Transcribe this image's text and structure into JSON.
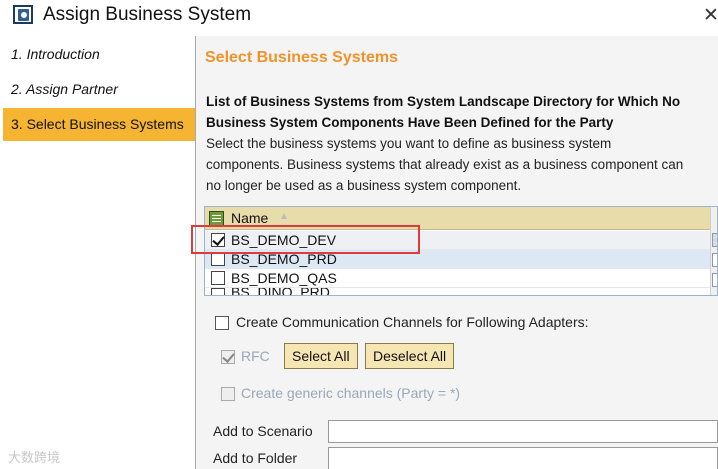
{
  "window": {
    "title": "Assign Business System",
    "close_label": "✕"
  },
  "nav": {
    "items": [
      {
        "label": "1. Introduction"
      },
      {
        "label": "2. Assign Partner"
      },
      {
        "label": "3. Select Business Systems"
      }
    ],
    "active_index": 2
  },
  "content": {
    "section_title": "Select Business Systems",
    "description_bold": "List of Business Systems from System Landscape Directory for Which No Business System Components Have Been Defined for the Party",
    "description_lines": [
      "Select the business systems you want to define as business system",
      "components. Business systems that already exist as a business component can",
      "no longer be used as a business system component."
    ]
  },
  "table": {
    "column_header": "Name",
    "sort_icon": "sort-ascending-icon",
    "rows": [
      {
        "label": "BS_DEMO_DEV",
        "checked": true
      },
      {
        "label": "BS_DEMO_PRD",
        "checked": false
      },
      {
        "label": "BS_DEMO_QAS",
        "checked": false
      },
      {
        "label": "BS_DINO_PRD",
        "checked": false
      }
    ]
  },
  "options": {
    "create_channels_label": "Create Communication Channels for Following Adapters:",
    "create_channels_checked": false,
    "rfc_label": "RFC",
    "rfc_checked": true,
    "select_all_label": "Select All",
    "deselect_all_label": "Deselect All",
    "generic_channels_label": "Create generic channels (Party = *)",
    "generic_channels_checked": false
  },
  "fields": {
    "scenario_label": "Add to Scenario",
    "scenario_value": "",
    "folder_label": "Add to Folder",
    "folder_value": ""
  },
  "watermark": "大数跨境",
  "colors": {
    "accent_orange": "#f0932b",
    "nav_active": "#f5b432",
    "table_header": "#e8dcab",
    "button_bg": "#f5e6b4",
    "highlight_red": "#e03a3a"
  }
}
